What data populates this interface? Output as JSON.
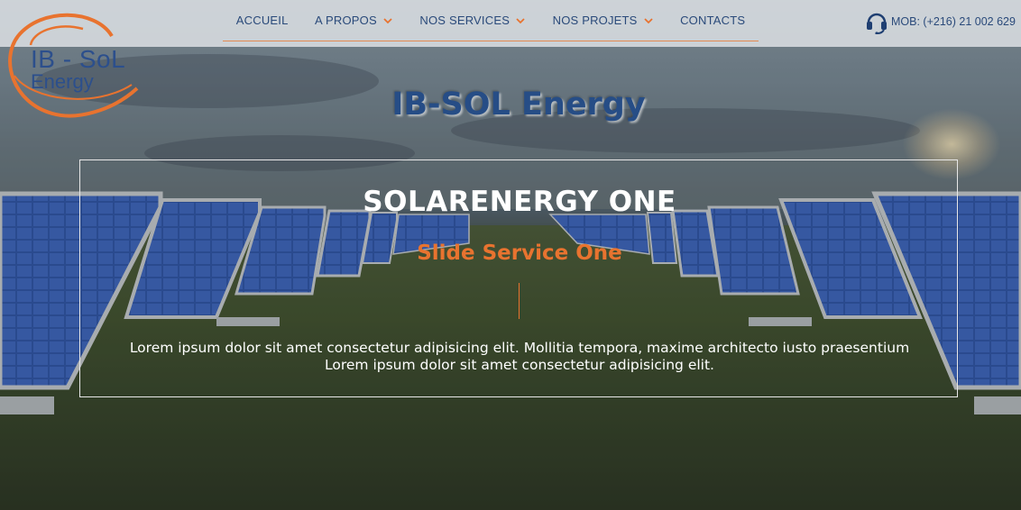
{
  "header": {
    "logo": {
      "line1": "IB - SoL",
      "line2": "Energy"
    },
    "nav": [
      {
        "label": "ACCUEIL",
        "has_dropdown": false
      },
      {
        "label": "A PROPOS",
        "has_dropdown": true
      },
      {
        "label": "NOS SERVICES",
        "has_dropdown": true
      },
      {
        "label": "NOS PROJETS",
        "has_dropdown": true
      },
      {
        "label": "CONTACTS",
        "has_dropdown": false
      }
    ],
    "contact": {
      "icon": "headset-icon",
      "text": "MOB: (+216) 21 002 629"
    }
  },
  "hero": {
    "site_title": "IB-SOL Energy",
    "slide": {
      "title": "SOLARENERGY ONE",
      "subtitle": "Slide Service One",
      "text_line1": "Lorem ipsum dolor sit amet consectetur adipisicing elit. Mollitia tempora, maxime architecto iusto praesentium",
      "text_line2": "Lorem ipsum dolor sit amet consectetur adipisicing elit."
    }
  },
  "colors": {
    "brand_blue": "#2a4a7a",
    "accent_orange": "#e8732f",
    "white": "#ffffff"
  }
}
